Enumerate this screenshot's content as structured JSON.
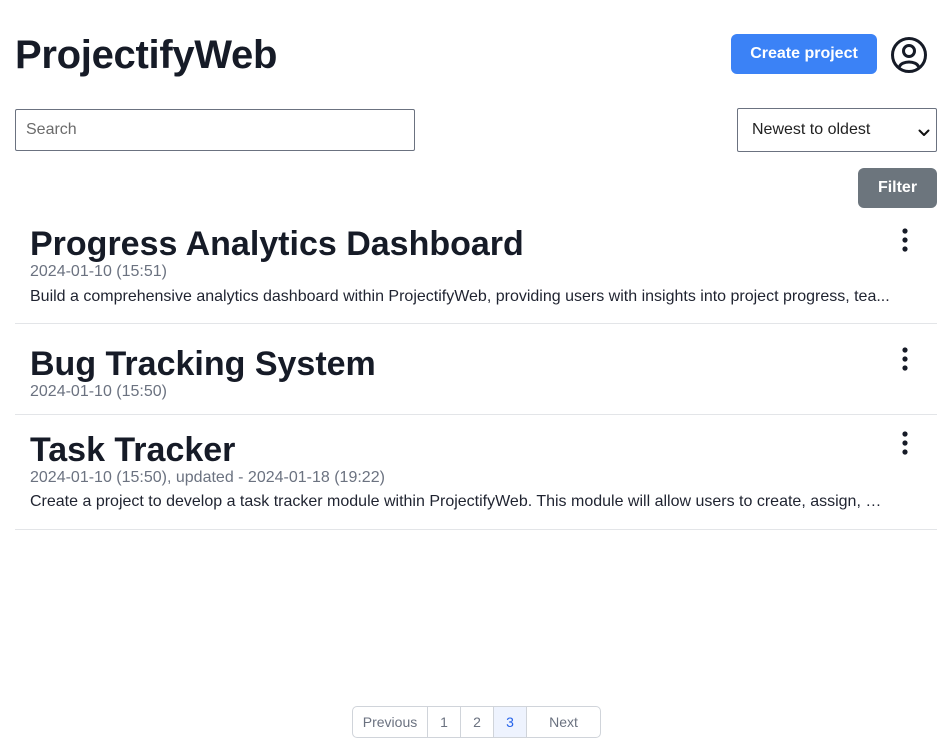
{
  "header": {
    "app_title": "ProjectifyWeb",
    "create_button_label": "Create project",
    "profile_icon": "user-circle-icon"
  },
  "toolbar": {
    "search_placeholder": "Search",
    "search_value": "",
    "sort_selected": "Newest to oldest",
    "filter_label": "Filter"
  },
  "projects": [
    {
      "title": "Progress Analytics Dashboard",
      "date": "2024-01-10 (15:51)",
      "description": "Build a comprehensive analytics dashboard within ProjectifyWeb, providing users with insights into project progress, tea..."
    },
    {
      "title": "Bug Tracking System",
      "date": "2024-01-10 (15:50)",
      "description": ""
    },
    {
      "title": "Task Tracker",
      "date": "2024-01-10 (15:50), updated - 2024-01-18 (19:22)",
      "description": "Create a project to develop a task tracker module within ProjectifyWeb. This module will allow users to create, assign, an..."
    }
  ],
  "pagination": {
    "previous_label": "Previous",
    "pages": [
      "1",
      "2",
      "3"
    ],
    "current_page": "3",
    "next_label": "Next"
  },
  "colors": {
    "primary": "#3b82f6",
    "secondary": "#6c757d",
    "text": "#161b27",
    "muted": "#6b7280"
  }
}
